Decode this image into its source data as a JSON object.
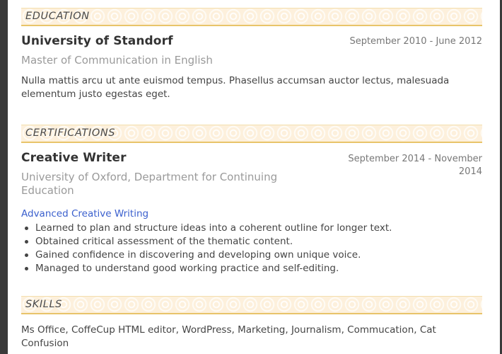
{
  "sections": {
    "education": {
      "title": "EDUCATION",
      "entries": [
        {
          "institution": "University of Standorf",
          "date": "September 2010 - June 2012",
          "degree": "Master of Communication in English",
          "description_lines": [
            "Nulla mattis arcu ut ante euismod tempus. Phasellus accumsan auctor lectus, malesuada",
            "elementum justo egestas eget."
          ]
        }
      ]
    },
    "certifications": {
      "title": "CERTIFICATIONS",
      "entries": [
        {
          "title": "Creative Writer",
          "date_lines": [
            "September 2014 - November",
            "2014"
          ],
          "issuer_lines": [
            "University of Oxford, Department for Continuing",
            "Education"
          ],
          "course_link": "Advanced Creative Writing",
          "bullets": [
            "Learned to plan and structure ideas into a coherent outline for longer text.",
            "Obtained critical assessment of the thematic content.",
            "Gained confidence in discovering and developing own unique voice.",
            "Managed to understand good working practice and self-editing."
          ]
        }
      ]
    },
    "skills": {
      "title": "SKILLS",
      "text_lines": [
        "Ms Office, CoffeCup HTML editor, WordPress, Marketing, Journalism, Commucation, Cat",
        "Confusion"
      ]
    }
  },
  "colors": {
    "header_band": "#fdf0dc",
    "header_rule": "#e8c46a",
    "link": "#3a5fcd",
    "frame": "#3a3a3a"
  }
}
